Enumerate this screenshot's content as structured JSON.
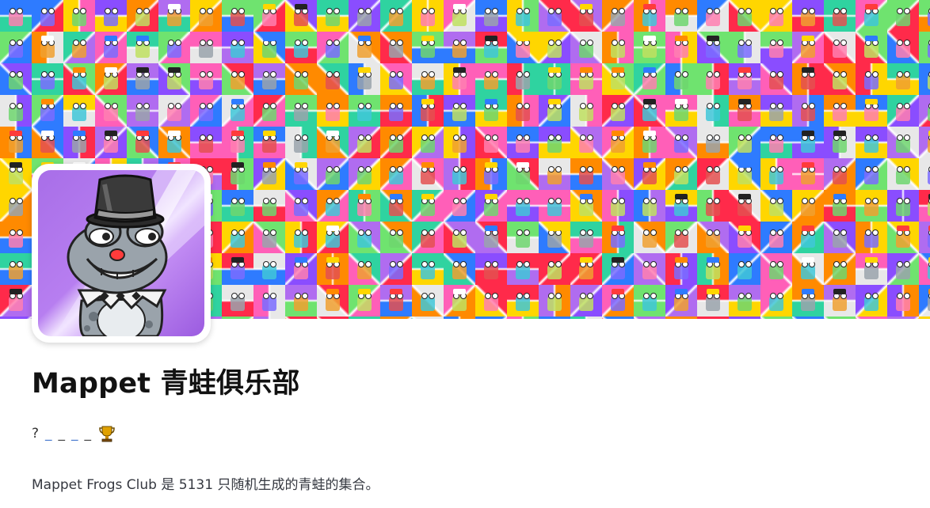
{
  "collection": {
    "name": "Mappet 青蛙俱乐部",
    "tagline_prefix": "?",
    "tagline_dashes": [
      "_",
      "_",
      "_",
      "_"
    ],
    "tagline_icon": "trophy-icon",
    "description": "Mappet Frogs Club 是 5131 只随机生成的青蛙的集合。"
  },
  "banner": {
    "icon": "frog-mosaic",
    "palette": [
      "#ff2a4a",
      "#ff8a00",
      "#ffd600",
      "#6fe36f",
      "#2fd3a0",
      "#2e7bff",
      "#8a4dff",
      "#ff5fb8",
      "#e8e8e8",
      "#b06cf0"
    ]
  },
  "avatar": {
    "icon": "frog-top-hat-avatar",
    "background": "#a86ee8"
  }
}
